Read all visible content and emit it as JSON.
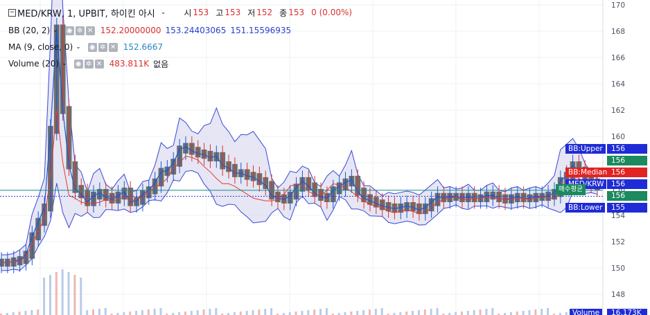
{
  "header": {
    "symbol": "MED/KRW, 1, UPBIT, 하이킨 아시",
    "open_label": "시",
    "open": "153",
    "high_label": "고",
    "high": "153",
    "low_label": "저",
    "low": "152",
    "close_label": "종",
    "close": "153",
    "change": "0 (0.00%)"
  },
  "indicators": {
    "bb": {
      "name": "BB (20, 2)",
      "v1": "152.20000000",
      "v2": "153.24403065",
      "v3": "151.15596935"
    },
    "ma": {
      "name": "MA (9, close, 0)",
      "v1": "152.6667"
    },
    "volume": {
      "name": "Volume (20)",
      "v1": "483.811K",
      "v2": "없음"
    }
  },
  "axis_labels": {
    "bb_upper": "BB:Upper",
    "bb_upper_val": "156",
    "green_val": "156",
    "bb_median": "BB:Median",
    "bb_median_val": "156",
    "pair": "MED/KRW",
    "pair_val": "156",
    "avg_buy": "매수평균",
    "avg_val": "156",
    "bb_lower": "BB:Lower",
    "bb_lower_val": "155",
    "volume": "Volume",
    "volume_val": "16.173K"
  },
  "colors": {
    "up": "#1a57d6",
    "down": "#d9322e",
    "ha_body": "#6e6e6e",
    "band_fill": "#dcdcf0",
    "band_line": "#3a46d6",
    "ma": "#e8392f",
    "grid": "#eef0f3"
  },
  "chart_data": {
    "type": "line",
    "title": "MED/KRW, 1, UPBIT, 하이킨 아시",
    "ylim": [
      147,
      170.5
    ],
    "y_ticks": [
      148,
      150,
      152,
      154,
      156,
      158,
      160,
      162,
      164,
      166,
      168,
      170
    ],
    "series": [
      {
        "name": "BB (20, 2)",
        "values": [
          150.4,
          150.4,
          150.5,
          150.6,
          151.0,
          152.4,
          153.5,
          154.6,
          160.5,
          168.2,
          162.0,
          157.8,
          156.0,
          155.6,
          155.0,
          155.5,
          155.7,
          155.4,
          155.2,
          155.5,
          155.8,
          155.0,
          155.1,
          155.6,
          155.9,
          156.5,
          157.3,
          157.4,
          158.0,
          159.0,
          159.2,
          158.9,
          158.7,
          158.6,
          158.4,
          158.5,
          157.8,
          157.6,
          157.2,
          157.2,
          157.0,
          156.9,
          156.6,
          156.3,
          155.5,
          155.3,
          155.2,
          155.5,
          156.1,
          156.6,
          156.2,
          155.7,
          155.4,
          155.3,
          155.9,
          156.2,
          156.5,
          156.7,
          155.8,
          155.3,
          155.1,
          154.9,
          154.7,
          154.6,
          154.5,
          154.6,
          154.7,
          154.6,
          154.4,
          154.6,
          155.0,
          155.4,
          155.3,
          155.4,
          155.4,
          155.3,
          155.4,
          155.3,
          155.3,
          155.5,
          155.5,
          155.3,
          155.2,
          155.3,
          155.4,
          155.3,
          155.3,
          155.4,
          155.4,
          155.5,
          155.7,
          156.6,
          157.0,
          157.8,
          157.4,
          156.8,
          156.5,
          156.2
        ]
      },
      {
        "name": "MA (9, close, 0)",
        "values": [
          150.4,
          150.4,
          150.5,
          150.5,
          150.9,
          151.8,
          152.8,
          153.7,
          157.0,
          162.0,
          158.0,
          155.5,
          155.3,
          155.0,
          154.9,
          154.9,
          155.0,
          155.2,
          155.1,
          155.2,
          155.4,
          155.1,
          155.2,
          155.4,
          155.8,
          156.1,
          156.4,
          156.8,
          157.6,
          158.0,
          158.5,
          158.4,
          158.2,
          157.7,
          157.3,
          156.8,
          156.4,
          156.4,
          156.2,
          155.9,
          155.6,
          155.3,
          155.2,
          155.1,
          155.1,
          155.2,
          155.6,
          156.2,
          156.4,
          156.3,
          155.8,
          155.6,
          155.5,
          155.9,
          156.4,
          156.3,
          156.1,
          155.8,
          155.4,
          155.1,
          154.8,
          154.7,
          154.6,
          154.3,
          154.2,
          154.3,
          154.4,
          154.3,
          154.1,
          154.2,
          154.6,
          155.0,
          155.2,
          155.3,
          155.4,
          155.2,
          155.2,
          155.3,
          155.3,
          155.4,
          155.3,
          155.3,
          155.2,
          155.2,
          155.3,
          155.3,
          155.2,
          155.3,
          155.4,
          155.3,
          155.3,
          155.6,
          156.0,
          157.0,
          156.8,
          156.5,
          156.4,
          156.2
        ]
      }
    ]
  }
}
